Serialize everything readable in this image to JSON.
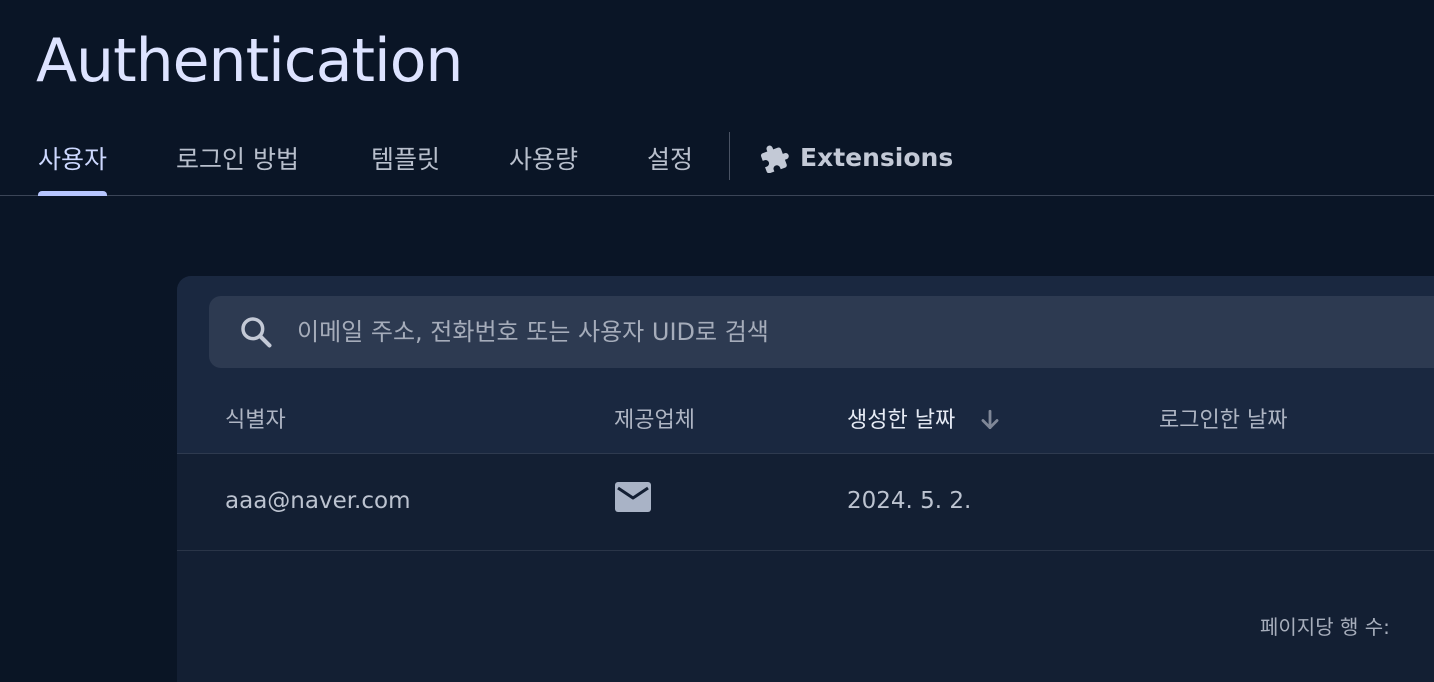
{
  "page": {
    "title": "Authentication"
  },
  "tabs": [
    {
      "label": "사용자",
      "active": true
    },
    {
      "label": "로그인 방법"
    },
    {
      "label": "템플릿"
    },
    {
      "label": "사용량"
    },
    {
      "label": "설정"
    },
    {
      "label": "Extensions",
      "icon": "puzzle-icon"
    }
  ],
  "search": {
    "placeholder": "이메일 주소, 전화번호 또는 사용자 UID로 검색",
    "value": ""
  },
  "table": {
    "columns": [
      "식별자",
      "제공업체",
      "생성한 날짜",
      "로그인한 날짜"
    ],
    "sorted_column": "생성한 날짜",
    "sort_direction": "descending",
    "rows": [
      {
        "identifier": "aaa@naver.com",
        "provider_icon": "mail-icon",
        "created": "2024. 5. 2.",
        "signed_in": ""
      }
    ]
  },
  "pagination": {
    "rows_per_page_label": "페이지당 행 수:"
  },
  "colors": {
    "background": "#0a1424",
    "card": "#131f33",
    "accent": "#b7c6ff"
  }
}
